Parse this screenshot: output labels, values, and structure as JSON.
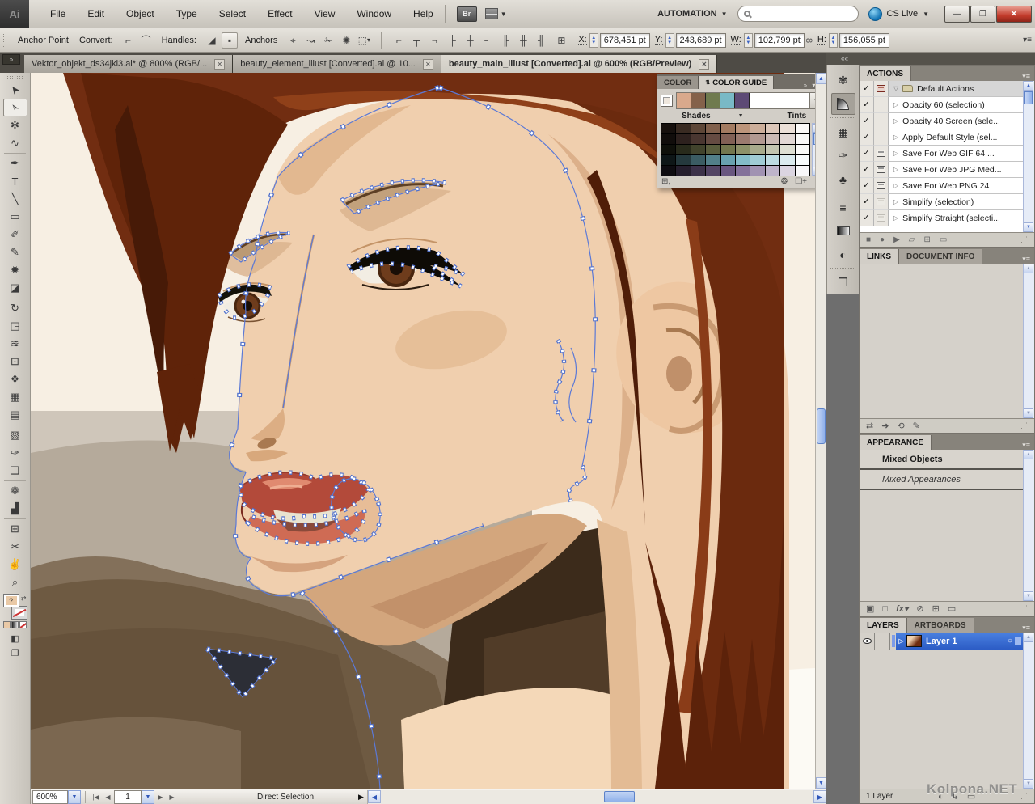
{
  "titlebar": {
    "logo": "Ai",
    "menus": [
      "File",
      "Edit",
      "Object",
      "Type",
      "Select",
      "Effect",
      "View",
      "Window",
      "Help"
    ],
    "bridge_label": "Br",
    "automation_label": "AUTOMATION",
    "cs_live_label": "CS Live",
    "search_placeholder": ""
  },
  "control_bar": {
    "mode_label": "Anchor Point",
    "convert_label": "Convert:",
    "handles_label": "Handles:",
    "anchors_label": "Anchors",
    "fields": [
      {
        "label": "X:",
        "value": "678,451 pt"
      },
      {
        "label": "Y:",
        "value": "243,689 pt"
      },
      {
        "label": "W:",
        "value": "102,799 pt"
      },
      {
        "label": "H:",
        "value": "156,055 pt"
      }
    ]
  },
  "tabs": [
    {
      "title": "Vektor_objekt_ds34jkl3.ai* @ 800% (RGB/...",
      "active": false
    },
    {
      "title": "beauty_element_illust [Converted].ai @ 10...",
      "active": false
    },
    {
      "title": "beauty_main_illust [Converted].ai @ 600% (RGB/Preview)",
      "active": true
    }
  ],
  "tools": [
    {
      "name": "selection-tool",
      "glyph": "➤",
      "rot": -128
    },
    {
      "name": "direct-selection-tool",
      "glyph": "➢",
      "rot": -128,
      "active": true
    },
    {
      "name": "magic-wand-tool",
      "glyph": "✻"
    },
    {
      "name": "lasso-tool",
      "glyph": "∿",
      "sep": true
    },
    {
      "name": "pen-tool",
      "glyph": "✒"
    },
    {
      "name": "type-tool",
      "glyph": "T"
    },
    {
      "name": "line-segment-tool",
      "glyph": "╲"
    },
    {
      "name": "rectangle-tool",
      "glyph": "▭"
    },
    {
      "name": "paintbrush-tool",
      "glyph": "✐"
    },
    {
      "name": "pencil-tool",
      "glyph": "✎"
    },
    {
      "name": "blob-brush-tool",
      "glyph": "✹"
    },
    {
      "name": "eraser-tool",
      "glyph": "◪",
      "sep": true
    },
    {
      "name": "rotate-tool",
      "glyph": "↻"
    },
    {
      "name": "scale-tool",
      "glyph": "◳"
    },
    {
      "name": "width-tool",
      "glyph": "≋"
    },
    {
      "name": "free-transform-tool",
      "glyph": "⊡"
    },
    {
      "name": "shape-builder-tool",
      "glyph": "❖"
    },
    {
      "name": "perspective-grid-tool",
      "glyph": "▦"
    },
    {
      "name": "mesh-tool",
      "glyph": "▤",
      "sep": true
    },
    {
      "name": "gradient-tool",
      "glyph": "▧"
    },
    {
      "name": "eyedropper-tool",
      "glyph": "✑"
    },
    {
      "name": "blend-tool",
      "glyph": "❏",
      "sep": true
    },
    {
      "name": "symbol-sprayer-tool",
      "glyph": "❁"
    },
    {
      "name": "graph-tool",
      "glyph": "▟",
      "sep": true
    },
    {
      "name": "artboard-tool",
      "glyph": "⊞"
    },
    {
      "name": "slice-tool",
      "glyph": "✂"
    },
    {
      "name": "hand-tool",
      "glyph": "✌"
    },
    {
      "name": "zoom-tool",
      "glyph": "⌕"
    }
  ],
  "dock_icons": [
    {
      "name": "color-panel-icon",
      "glyph": "✾"
    },
    {
      "name": "color-guide-panel-icon",
      "type": "cone",
      "active": true,
      "sep": true
    },
    {
      "name": "swatches-panel-icon",
      "glyph": "▦"
    },
    {
      "name": "brushes-panel-icon",
      "glyph": "✑"
    },
    {
      "name": "symbols-panel-icon",
      "glyph": "♣",
      "sep": true
    },
    {
      "name": "stroke-panel-icon",
      "glyph": "≡"
    },
    {
      "name": "gradient-panel-icon",
      "type": "grad"
    },
    {
      "name": "transparency-panel-icon",
      "glyph": "◐",
      "sep": true
    },
    {
      "name": "navigator-panel-icon",
      "glyph": "❐"
    }
  ],
  "color_guide": {
    "tab_color": "COLOR",
    "tab_guide": "COLOR GUIDE",
    "shades_label": "Shades",
    "tints_label": "Tints",
    "harmony_colors": [
      "#d9a98c",
      "#84614a",
      "#6f7a4e",
      "#79b9c6",
      "#5d4a75"
    ],
    "grid_base_colors": [
      "#b5886b",
      "#8f6a5e",
      "#7f8457",
      "#74b4c2",
      "#76608e"
    ],
    "grid_cols": 10
  },
  "actions_panel": {
    "title": "ACTIONS",
    "rows": [
      {
        "label": "Default Actions",
        "folder": true,
        "modal": "red",
        "checked": true
      },
      {
        "label": "Opacity 60 (selection)",
        "modal": "none",
        "checked": true
      },
      {
        "label": "Opacity 40 Screen (sele...",
        "modal": "none",
        "checked": true
      },
      {
        "label": "Apply Default Style (sel...",
        "modal": "none",
        "checked": true
      },
      {
        "label": "Save For Web GIF 64 ...",
        "modal": "on",
        "checked": true
      },
      {
        "label": "Save For Web JPG Med...",
        "modal": "on",
        "checked": true
      },
      {
        "label": "Save For Web PNG 24",
        "modal": "on",
        "checked": true
      },
      {
        "label": "Simplify (selection)",
        "modal": "off",
        "checked": true
      },
      {
        "label": "Simplify Straight (selecti...",
        "modal": "off",
        "checked": true
      }
    ]
  },
  "links_panel": {
    "tab_links": "LINKS",
    "tab_info": "DOCUMENT INFO"
  },
  "appearance_panel": {
    "title": "APPEARANCE",
    "object_label": "Mixed Objects",
    "detail_label": "Mixed Appearances"
  },
  "layers_panel": {
    "tab_layers": "LAYERS",
    "tab_artboards": "ARTBOARDS",
    "layer_name": "Layer 1",
    "count_label": "1 Layer"
  },
  "status_bar": {
    "zoom_level": "600%",
    "artboard_number": "1",
    "current_tool": "Direct Selection"
  },
  "watermark": "Kolpona.NET",
  "colors": {
    "selection_blue": "#5b79d6",
    "layer_selected": "#3567cf",
    "close_button": "#c23b2b",
    "scroll_accent": "#4d6fc6"
  }
}
